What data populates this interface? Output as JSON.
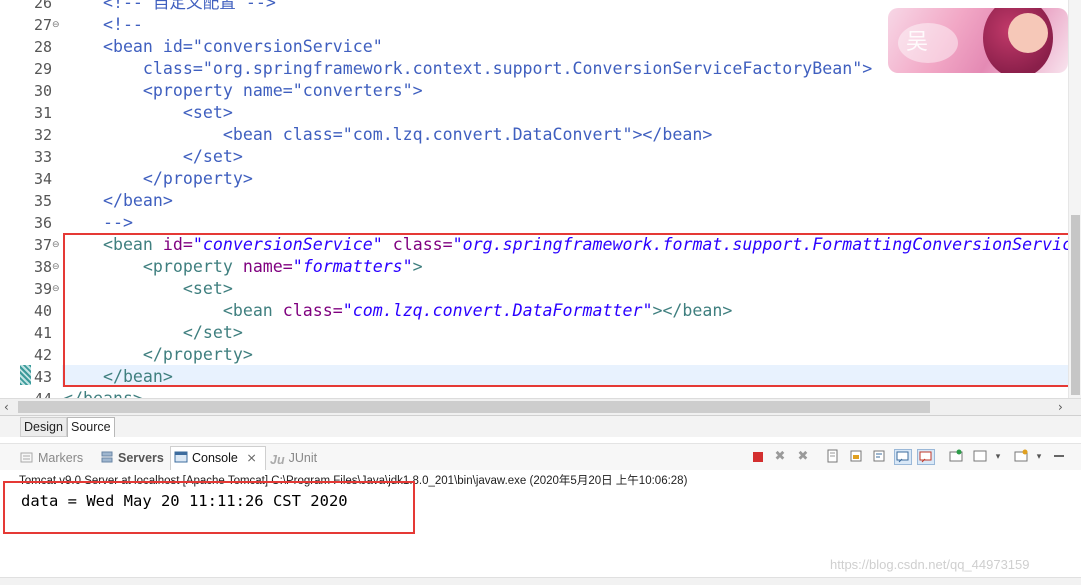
{
  "editor": {
    "lines": [
      {
        "num": "26",
        "fold": "",
        "parts": [
          {
            "cls": "cmt",
            "t": "    <!-- 自定义配置 -->"
          }
        ]
      },
      {
        "num": "27",
        "fold": "⊖",
        "parts": [
          {
            "cls": "cmt",
            "t": "    <!--"
          }
        ]
      },
      {
        "num": "28",
        "fold": "",
        "parts": [
          {
            "cls": "cmt",
            "t": "    <bean id=\"conversionService\""
          }
        ]
      },
      {
        "num": "29",
        "fold": "",
        "parts": [
          {
            "cls": "cmt",
            "t": "        class=\"org.springframework.context.support.ConversionServiceFactoryBean\">"
          }
        ]
      },
      {
        "num": "30",
        "fold": "",
        "parts": [
          {
            "cls": "cmt",
            "t": "        <property name=\"converters\">"
          }
        ]
      },
      {
        "num": "31",
        "fold": "",
        "parts": [
          {
            "cls": "cmt",
            "t": "            <set>"
          }
        ]
      },
      {
        "num": "32",
        "fold": "",
        "parts": [
          {
            "cls": "cmt",
            "t": "                <bean class=\"com.lzq.convert.DataConvert\"></bean>"
          }
        ]
      },
      {
        "num": "33",
        "fold": "",
        "parts": [
          {
            "cls": "cmt",
            "t": "            </set>"
          }
        ]
      },
      {
        "num": "34",
        "fold": "",
        "parts": [
          {
            "cls": "cmt",
            "t": "        </property>"
          }
        ]
      },
      {
        "num": "35",
        "fold": "",
        "parts": [
          {
            "cls": "cmt",
            "t": "    </bean>"
          }
        ]
      },
      {
        "num": "36",
        "fold": "",
        "parts": [
          {
            "cls": "cmt",
            "t": "    -->"
          }
        ]
      },
      {
        "num": "37",
        "fold": "⊖",
        "parts": [
          {
            "cls": "tag",
            "t": "    <bean "
          },
          {
            "cls": "attr",
            "t": "id="
          },
          {
            "cls": "val",
            "t": "\"conversionService\""
          },
          {
            "cls": "tag",
            "t": " "
          },
          {
            "cls": "attr",
            "t": "class="
          },
          {
            "cls": "val",
            "t": "\"org.springframework.format.support.FormattingConversionServiceFactoryBean\""
          },
          {
            "cls": "tag",
            "t": ">"
          }
        ]
      },
      {
        "num": "38",
        "fold": "⊖",
        "parts": [
          {
            "cls": "tag",
            "t": "        <property "
          },
          {
            "cls": "attr",
            "t": "name="
          },
          {
            "cls": "val",
            "t": "\"formatters\""
          },
          {
            "cls": "tag",
            "t": ">"
          }
        ]
      },
      {
        "num": "39",
        "fold": "⊖",
        "parts": [
          {
            "cls": "tag",
            "t": "            <set>"
          }
        ]
      },
      {
        "num": "40",
        "fold": "",
        "parts": [
          {
            "cls": "tag",
            "t": "                <bean "
          },
          {
            "cls": "attr",
            "t": "class="
          },
          {
            "cls": "val",
            "t": "\"com.lzq.convert.DataFormatter\""
          },
          {
            "cls": "tag",
            "t": "></bean>"
          }
        ]
      },
      {
        "num": "41",
        "fold": "",
        "parts": [
          {
            "cls": "tag",
            "t": "            </set>"
          }
        ]
      },
      {
        "num": "42",
        "fold": "",
        "parts": [
          {
            "cls": "tag",
            "t": "        </property>"
          }
        ]
      },
      {
        "num": "43",
        "fold": "",
        "parts": [
          {
            "cls": "tag",
            "t": "    </bean>"
          }
        ]
      },
      {
        "num": "44",
        "fold": "",
        "parts": [
          {
            "cls": "tag",
            "t": "</beans>"
          }
        ]
      }
    ],
    "avatar_signature": "吴"
  },
  "editor_tabs": {
    "design": "Design",
    "source": "Source"
  },
  "view_tabs": {
    "markers": "Markers",
    "servers": "Servers",
    "console": "Console",
    "console_close": "⨯",
    "junit": "JUnit"
  },
  "console": {
    "process": "Tomcat v9.0 Server at localhost [Apache Tomcat] C:\\Program Files\\Java\\jdk1.8.0_201\\bin\\javaw.exe (2020年5月20日 上午10:06:28)",
    "output": "data = Wed May 20 11:11:26 CST 2020"
  },
  "watermark": "https://blog.csdn.net/qq_44973159",
  "colors": {
    "highlight_box": "#e53935",
    "tag": "#3f7f7f",
    "attr": "#7f007f",
    "value": "#2a00ff",
    "comment": "#3f5fbf"
  }
}
